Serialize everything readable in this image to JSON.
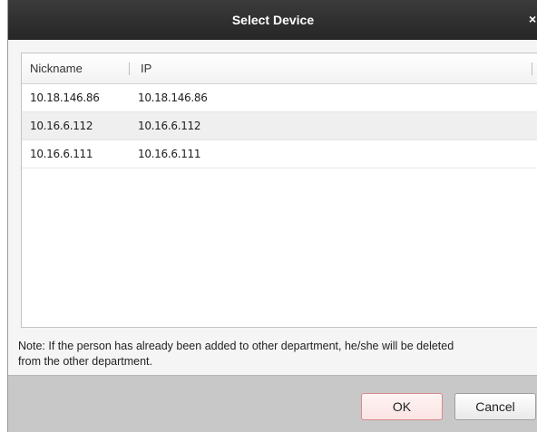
{
  "dialog": {
    "title": "Select Device",
    "close_glyph": "×"
  },
  "table": {
    "headers": {
      "nickname": "Nickname",
      "ip": "IP"
    },
    "rows": [
      {
        "nickname": "10.18.146.86",
        "ip": "10.18.146.86"
      },
      {
        "nickname": "10.16.6.112",
        "ip": "10.16.6.112"
      },
      {
        "nickname": "10.16.6.111",
        "ip": "10.16.6.111"
      }
    ]
  },
  "note": {
    "line1": "Note: If the person has already been added to other department, he/she will be deleted",
    "line2": "from the other department."
  },
  "buttons": {
    "ok": "OK",
    "cancel": "Cancel"
  },
  "colors": {
    "titlebar": "#2f2f2f",
    "footer": "#c8c8c8",
    "ok_border": "#d98a8a"
  }
}
